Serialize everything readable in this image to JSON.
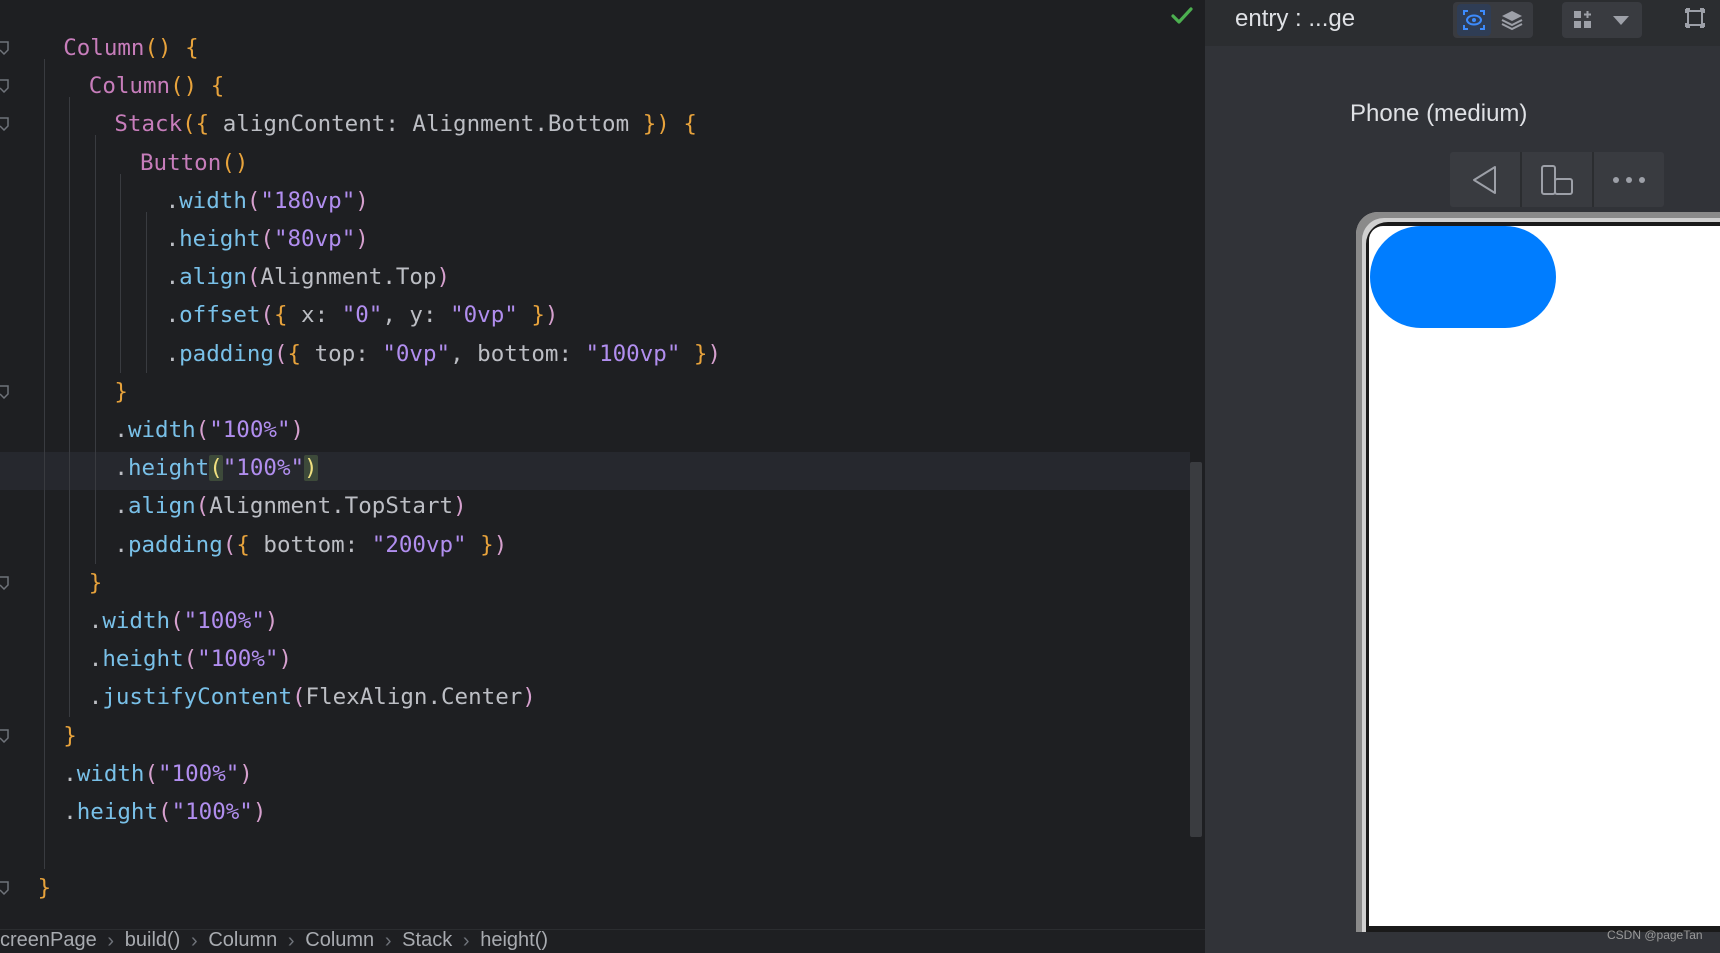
{
  "editor": {
    "lines": [
      {
        "indent": 2,
        "tokens": [
          [
            "ty",
            "Column"
          ],
          [
            "pa",
            "()"
          ],
          [
            "id",
            " "
          ],
          [
            "br",
            "{"
          ]
        ]
      },
      {
        "indent": 3,
        "tokens": [
          [
            "ty",
            "Column"
          ],
          [
            "pa",
            "()"
          ],
          [
            "id",
            " "
          ],
          [
            "br",
            "{"
          ]
        ]
      },
      {
        "indent": 4,
        "tokens": [
          [
            "ty",
            "Stack"
          ],
          [
            "pa",
            "("
          ],
          [
            "br",
            "{"
          ],
          [
            "id",
            " alignContent: Alignment.Bottom "
          ],
          [
            "br",
            "}"
          ],
          [
            "pa",
            ")"
          ],
          [
            "id",
            " "
          ],
          [
            "br",
            "{"
          ]
        ]
      },
      {
        "indent": 5,
        "tokens": [
          [
            "ty",
            "Button"
          ],
          [
            "pa",
            "()"
          ]
        ]
      },
      {
        "indent": 6,
        "tokens": [
          [
            "id",
            "."
          ],
          [
            "mt",
            "width"
          ],
          [
            "pk",
            "("
          ],
          [
            "str",
            "\"180vp\""
          ],
          [
            "pk",
            ")"
          ]
        ]
      },
      {
        "indent": 6,
        "tokens": [
          [
            "id",
            "."
          ],
          [
            "mt",
            "height"
          ],
          [
            "pk",
            "("
          ],
          [
            "str",
            "\"80vp\""
          ],
          [
            "pk",
            ")"
          ]
        ]
      },
      {
        "indent": 6,
        "tokens": [
          [
            "id",
            "."
          ],
          [
            "mt",
            "align"
          ],
          [
            "pk",
            "("
          ],
          [
            "id",
            "Alignment.Top"
          ],
          [
            "pk",
            ")"
          ]
        ]
      },
      {
        "indent": 6,
        "tokens": [
          [
            "id",
            "."
          ],
          [
            "mt",
            "offset"
          ],
          [
            "pk",
            "("
          ],
          [
            "br",
            "{"
          ],
          [
            "id",
            " x: "
          ],
          [
            "str",
            "\"0\""
          ],
          [
            "id",
            ", y: "
          ],
          [
            "str",
            "\"0vp\""
          ],
          [
            "id",
            " "
          ],
          [
            "br",
            "}"
          ],
          [
            "pk",
            ")"
          ]
        ]
      },
      {
        "indent": 6,
        "tokens": [
          [
            "id",
            "."
          ],
          [
            "mt",
            "padding"
          ],
          [
            "pk",
            "("
          ],
          [
            "br",
            "{"
          ],
          [
            "id",
            " top: "
          ],
          [
            "str",
            "\"0vp\""
          ],
          [
            "id",
            ", bottom: "
          ],
          [
            "str",
            "\"100vp\""
          ],
          [
            "id",
            " "
          ],
          [
            "br",
            "}"
          ],
          [
            "pk",
            ")"
          ]
        ]
      },
      {
        "indent": 4,
        "tokens": [
          [
            "br",
            "}"
          ]
        ]
      },
      {
        "indent": 4,
        "tokens": [
          [
            "id",
            "."
          ],
          [
            "mt",
            "width"
          ],
          [
            "pk",
            "("
          ],
          [
            "str",
            "\"100%\""
          ],
          [
            "pk",
            ")"
          ]
        ]
      },
      {
        "indent": 4,
        "tokens": [
          [
            "id",
            "."
          ],
          [
            "mt",
            "height"
          ],
          [
            "hl",
            "("
          ],
          [
            "str",
            "\"100%\""
          ],
          [
            "hl",
            ")"
          ]
        ]
      },
      {
        "indent": 4,
        "tokens": [
          [
            "id",
            "."
          ],
          [
            "mt",
            "align"
          ],
          [
            "pk",
            "("
          ],
          [
            "id",
            "Alignment.TopStart"
          ],
          [
            "pk",
            ")"
          ]
        ]
      },
      {
        "indent": 4,
        "tokens": [
          [
            "id",
            "."
          ],
          [
            "mt",
            "padding"
          ],
          [
            "pk",
            "("
          ],
          [
            "br",
            "{"
          ],
          [
            "id",
            " bottom: "
          ],
          [
            "str",
            "\"200vp\""
          ],
          [
            "id",
            " "
          ],
          [
            "br",
            "}"
          ],
          [
            "pk",
            ")"
          ]
        ]
      },
      {
        "indent": 3,
        "tokens": [
          [
            "br",
            "}"
          ]
        ]
      },
      {
        "indent": 3,
        "tokens": [
          [
            "id",
            "."
          ],
          [
            "mt",
            "width"
          ],
          [
            "pk",
            "("
          ],
          [
            "str",
            "\"100%\""
          ],
          [
            "pk",
            ")"
          ]
        ]
      },
      {
        "indent": 3,
        "tokens": [
          [
            "id",
            "."
          ],
          [
            "mt",
            "height"
          ],
          [
            "pk",
            "("
          ],
          [
            "str",
            "\"100%\""
          ],
          [
            "pk",
            ")"
          ]
        ]
      },
      {
        "indent": 3,
        "tokens": [
          [
            "id",
            "."
          ],
          [
            "mt",
            "justifyContent"
          ],
          [
            "pk",
            "("
          ],
          [
            "id",
            "FlexAlign.Center"
          ],
          [
            "pk",
            ")"
          ]
        ]
      },
      {
        "indent": 2,
        "tokens": [
          [
            "br",
            "}"
          ]
        ]
      },
      {
        "indent": 2,
        "tokens": [
          [
            "id",
            "."
          ],
          [
            "mt",
            "width"
          ],
          [
            "pk",
            "("
          ],
          [
            "str",
            "\"100%\""
          ],
          [
            "pk",
            ")"
          ]
        ]
      },
      {
        "indent": 2,
        "tokens": [
          [
            "id",
            "."
          ],
          [
            "mt",
            "height"
          ],
          [
            "pk",
            "("
          ],
          [
            "str",
            "\"100%\""
          ],
          [
            "pk",
            ")"
          ]
        ]
      },
      {
        "indent": 0,
        "tokens": []
      },
      {
        "indent": 1,
        "tokens": [
          [
            "br",
            "}"
          ]
        ]
      }
    ]
  },
  "breadcrumb": [
    "creenPage",
    "build()",
    "Column",
    "Column",
    "Stack",
    "height()"
  ],
  "preview": {
    "title": "entry : ...ge",
    "device_name": "Phone (medium)",
    "accent_color": "#007dff"
  },
  "watermark": "CSDN @pageTan"
}
